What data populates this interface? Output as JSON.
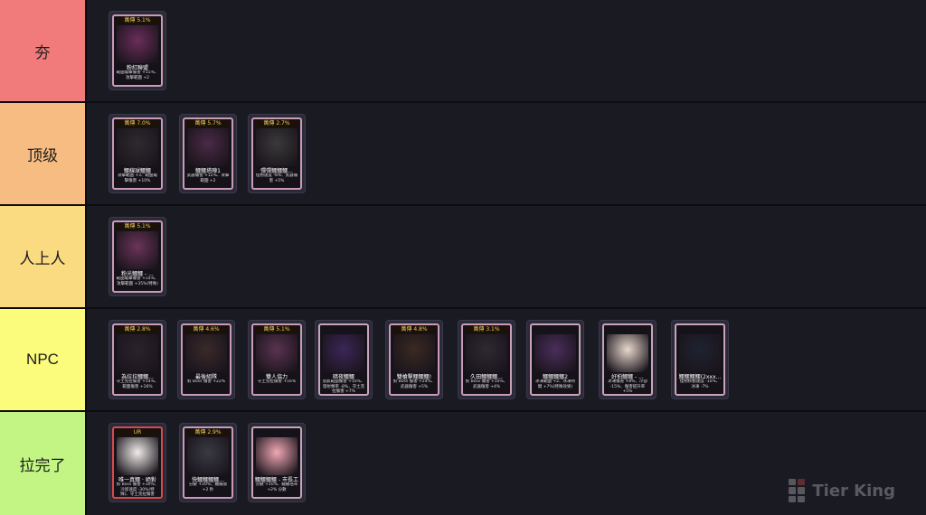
{
  "tiers": [
    {
      "label": "夯",
      "color": "#f17b7a",
      "cards": [
        {
          "badge": "萬傳 5.1%",
          "name": "粉紅聯盟",
          "desc": "範圍電擊傷害 +15%、攻擊範圍 +2",
          "art": "#6a2e5a",
          "frame": "#c99bb5"
        }
      ]
    },
    {
      "label": "顶级",
      "color": "#f7bc81",
      "cards": [
        {
          "badge": "萬傳 7.0%",
          "name": "鱷線球鱷鱷",
          "desc": "攻擊範圍 +3、範圍電擊傷害 +10%",
          "art": "#2f2a2f",
          "frame": "#c99bb5"
        },
        {
          "badge": "萬傳 5.7%",
          "name": "鱷鱷塔陣1",
          "desc": "武器傷害 +12%、攻擊範圍 +2",
          "art": "#4a2a45",
          "frame": "#c99bb5"
        },
        {
          "badge": "萬傳 2.7%",
          "name": "彈彈鱷鱷鱷...",
          "desc": "怪物速度 -8%、武器傷害 +5%",
          "art": "#3a3a3a",
          "frame": "#c99bb5"
        }
      ]
    },
    {
      "label": "人上人",
      "color": "#fbdb82",
      "cards": [
        {
          "badge": "萬傳 5.1%",
          "name": "粉光鱷鱷 - ...",
          "desc": "範圍電擊傷害 +14%、攻擊範圍 +35%(特殊)",
          "art": "#6b3559",
          "frame": "#c99bb5"
        }
      ]
    },
    {
      "label": "NPC",
      "color": "#fbfb7c",
      "cards": [
        {
          "badge": "萬傳 2.8%",
          "name": "為拉拉鱷鱷...",
          "desc": "守土克拉傷害 +14%、範圍傷害 +16%",
          "art": "#2b232b",
          "frame": "#c99bb5"
        },
        {
          "badge": "萬傳 4.6%",
          "name": "最後組隊",
          "desc": "對 Boss 傷害 +22%",
          "art": "#3a2a2a",
          "frame": "#c99bb5"
        },
        {
          "badge": "萬傳 5.1%",
          "name": "雙人協力",
          "desc": "守土克拉傷害 +16%",
          "art": "#5a3350",
          "frame": "#c99bb5"
        },
        {
          "badge": "",
          "name": "暗夜鱷鱷",
          "desc": "怒氣範圍傷害 +10%、發射頻率 -8%、守土克拉傷害 +7%",
          "art": "#3b2658",
          "frame": "#c9a4b8"
        },
        {
          "badge": "萬傳 4.8%",
          "name": "雙槍擊鱷鱷鱷!",
          "desc": "對 Boss 傷害 +24%、武器傷害 +5%",
          "art": "#3a2a22",
          "frame": "#c99bb5"
        },
        {
          "badge": "萬傳 3.1%",
          "name": "久田鱷鱷鱷...",
          "desc": "對 Boss 傷害 +10%、武器傷害 +4%",
          "art": "#2e2a32",
          "frame": "#c99bb5"
        },
        {
          "badge": "",
          "name": "鱷鱷鱷鱷2",
          "desc": "冰凍範圍 +2、冰凍時間 +7%(特殊效果)",
          "art": "#4b2e5c",
          "frame": "#c9a4b8"
        },
        {
          "badge": "",
          "name": "好拍鱷鱷 - ...",
          "desc": "冰凍傷害 +8%、冷卻 -15%、傷害提升率 +5%",
          "art": "#e8d8cc",
          "frame": "#c9a4b8"
        },
        {
          "badge": "",
          "name": "鱷鱷鱷鱷(2xxx...",
          "desc": "怪物移動速度 -10%、冰凍 -7%",
          "art": "#1f2330",
          "frame": "#c9a4b8"
        }
      ]
    },
    {
      "label": "拉完了",
      "color": "#c2f583",
      "cards": [
        {
          "badge": "UR",
          "name": "唯一真鱷 · 絕對",
          "desc": "對 Boss 傷害 +30%、冷卻速度 -30%(特殊)、守土克拉傷害 +7%",
          "art": "#f0ece8",
          "frame": "#d94a4a"
        },
        {
          "badge": "萬傳 2.9%",
          "name": "快鱷鱷鱷鱷...",
          "desc": "分數 +20%、鱷鱷漿 +2 秒",
          "art": "#3a3a44",
          "frame": "#c99bb5"
        },
        {
          "badge": "",
          "name": "鱷鱷鱷鱷 - 市長工具",
          "desc": "分數 +10%、鱷鱷倍率 +2% 分數",
          "art": "#f0a8b4",
          "frame": "#c9a4b8"
        }
      ]
    }
  ],
  "watermark": {
    "text": "Tier King"
  }
}
